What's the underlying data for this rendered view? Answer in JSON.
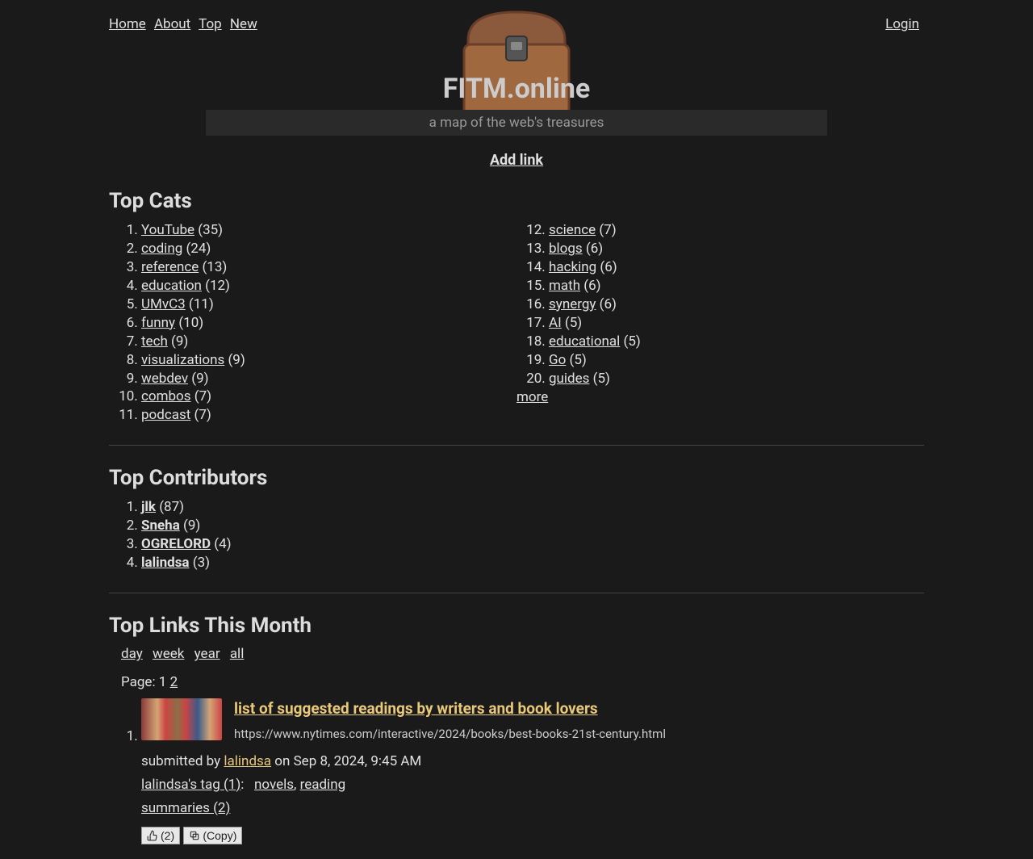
{
  "nav": {
    "home": "Home",
    "about": "About",
    "top": "Top",
    "new": "New",
    "login": "Login"
  },
  "header": {
    "title": "FITM.online",
    "tagline": "a map of the web's treasures",
    "add_link": "Add link"
  },
  "sections": {
    "top_cats": "Top Cats",
    "top_contributors": "Top Contributors",
    "top_links": "Top Links This Month"
  },
  "cats1": [
    {
      "name": "YouTube",
      "count": 35
    },
    {
      "name": "coding",
      "count": 24
    },
    {
      "name": "reference",
      "count": 13
    },
    {
      "name": "education",
      "count": 12
    },
    {
      "name": "UMvC3",
      "count": 11
    },
    {
      "name": "funny",
      "count": 10
    },
    {
      "name": "tech",
      "count": 9
    },
    {
      "name": "visualizations",
      "count": 9
    },
    {
      "name": "webdev",
      "count": 9
    },
    {
      "name": "combos",
      "count": 7
    },
    {
      "name": "podcast",
      "count": 7
    }
  ],
  "cats2": [
    {
      "name": "science",
      "count": 7
    },
    {
      "name": "blogs",
      "count": 6
    },
    {
      "name": "hacking",
      "count": 6
    },
    {
      "name": "math",
      "count": 6
    },
    {
      "name": "synergy",
      "count": 6
    },
    {
      "name": "AI",
      "count": 5
    },
    {
      "name": "educational",
      "count": 5
    },
    {
      "name": "Go",
      "count": 5
    },
    {
      "name": "guides",
      "count": 5
    }
  ],
  "more": "more",
  "contributors": [
    {
      "name": "jlk",
      "count": 87
    },
    {
      "name": "Sneha",
      "count": 9
    },
    {
      "name": "OGRELORD",
      "count": 4
    },
    {
      "name": "lalindsa",
      "count": 3
    }
  ],
  "periods": {
    "day": "day",
    "week": "week",
    "year": "year",
    "all": "all"
  },
  "pagination": {
    "label": "Page:",
    "current": "1",
    "next": "2"
  },
  "link": {
    "title": "list of suggested readings by writers and book lovers",
    "url": "https://www.nytimes.com/interactive/2024/books/best-books-21st-century.html",
    "submitted_prefix": "submitted by",
    "submitter": "lalindsa",
    "submitted_suffix": "on Sep 8, 2024, 9:45 AM",
    "tag_link": "lalindsa's tag (1)",
    "tag1": "novels",
    "tag2": "reading",
    "summaries": "summaries (2)",
    "like_label": "(2)",
    "copy_label": "(Copy)"
  }
}
